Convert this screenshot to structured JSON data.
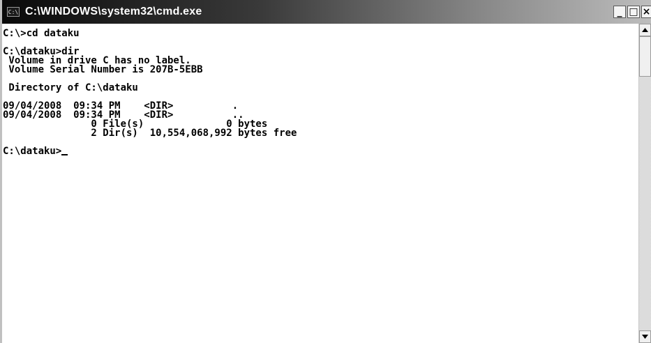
{
  "window": {
    "title": "C:\\WINDOWS\\system32\\cmd.exe",
    "icon": "console-icon",
    "icon_glyph": "C:\\",
    "buttons": {
      "minimize": "_",
      "maximize": "□",
      "close": "×"
    }
  },
  "console": {
    "lines": [
      "C:\\>cd dataku",
      "",
      "C:\\dataku>dir",
      " Volume in drive C has no label.",
      " Volume Serial Number is 207B-5EBB",
      "",
      " Directory of C:\\dataku",
      "",
      "09/04/2008  09:34 PM    <DIR>          .",
      "09/04/2008  09:34 PM    <DIR>          ..",
      "               0 File(s)              0 bytes",
      "               2 Dir(s)  10,554,068,992 bytes free",
      "",
      "C:\\dataku>"
    ]
  },
  "colors": {
    "background": "#ffffff",
    "text": "#000000",
    "titlebar_start": "#0a0a0a",
    "titlebar_end": "#bdbdbd"
  }
}
